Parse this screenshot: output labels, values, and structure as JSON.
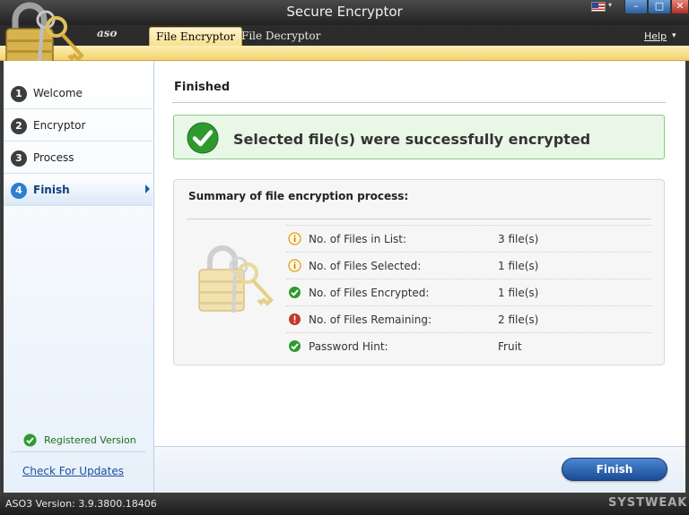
{
  "window": {
    "title": "Secure Encryptor"
  },
  "brand": {
    "logo_text": "aso"
  },
  "tabs": [
    {
      "label": "File Encryptor",
      "active": true
    },
    {
      "label": "File Decryptor",
      "active": false
    }
  ],
  "header": {
    "help_label": "Help"
  },
  "sidebar": {
    "steps": [
      {
        "number": "1",
        "label": "Welcome",
        "active": false
      },
      {
        "number": "2",
        "label": "Encryptor",
        "active": false
      },
      {
        "number": "3",
        "label": "Process",
        "active": false
      },
      {
        "number": "4",
        "label": "Finish",
        "active": true
      }
    ],
    "registered_label": "Registered Version",
    "check_updates_label": "Check For Updates"
  },
  "main": {
    "title": "Finished",
    "success_message": "Selected file(s) were successfully encrypted",
    "summary": {
      "title": "Summary of file encryption process:",
      "rows": [
        {
          "icon": "info-icon",
          "label": "No. of Files in List:",
          "value": "3 file(s)"
        },
        {
          "icon": "info-icon",
          "label": "No. of Files Selected:",
          "value": "1 file(s)"
        },
        {
          "icon": "check-icon",
          "label": "No. of Files Encrypted:",
          "value": "1 file(s)"
        },
        {
          "icon": "error-icon",
          "label": "No. of Files Remaining:",
          "value": "2 file(s)"
        },
        {
          "icon": "check-icon",
          "label": "Password Hint:",
          "value": "Fruit"
        }
      ]
    }
  },
  "footer": {
    "finish_label": "Finish"
  },
  "statusbar": {
    "version": "ASO3 Version: 3.9.3800.18406",
    "watermark": "SYSTWEAK"
  },
  "colors": {
    "accent": "#2a7fd0",
    "success": "#2e9a2e",
    "warning": "#e0a020",
    "error": "#c0392b",
    "tab_gold": "#f7e08a"
  }
}
